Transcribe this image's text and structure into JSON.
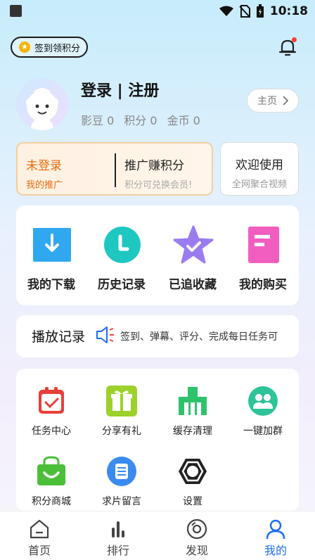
{
  "status_bar": {
    "time": "10:18"
  },
  "header": {
    "signin_label": "签到领积分"
  },
  "profile": {
    "login_text": "登录 | 注册",
    "stats": [
      "影豆 0",
      "积分 0",
      "金币 0"
    ],
    "home_button": "主页"
  },
  "promo": {
    "left_title": "未登录",
    "left_sub": "我的推广",
    "right_title": "推广赚积分",
    "right_sub": "积分可兑换会员!"
  },
  "welcome": {
    "title": "欢迎使用",
    "sub": "全网聚合视频"
  },
  "quick": [
    {
      "label": "我的下载",
      "icon": "download-icon"
    },
    {
      "label": "历史记录",
      "icon": "history-icon"
    },
    {
      "label": "已追收藏",
      "icon": "favorite-star-icon"
    },
    {
      "label": "我的购买",
      "icon": "purchase-icon"
    }
  ],
  "play_record": {
    "title": "播放记录",
    "marquee": "签到、弹幕、评分、完成每日任务可"
  },
  "tools": [
    {
      "label": "任务中心",
      "icon": "task-center-icon"
    },
    {
      "label": "分享有礼",
      "icon": "gift-icon"
    },
    {
      "label": "缓存清理",
      "icon": "cache-clean-icon"
    },
    {
      "label": "一键加群",
      "icon": "group-icon"
    },
    {
      "label": "积分商城",
      "icon": "shop-bag-icon"
    },
    {
      "label": "求片留言",
      "icon": "message-icon"
    },
    {
      "label": "设置",
      "icon": "settings-icon"
    }
  ],
  "tabs": [
    {
      "label": "首页",
      "icon": "home-icon"
    },
    {
      "label": "排行",
      "icon": "ranking-icon"
    },
    {
      "label": "发现",
      "icon": "discover-icon"
    },
    {
      "label": "我的",
      "icon": "profile-icon"
    }
  ],
  "colors": {
    "accent_blue": "#1e6cf5",
    "promo_orange": "#e96b10",
    "notification_red": "#ff3b30"
  }
}
